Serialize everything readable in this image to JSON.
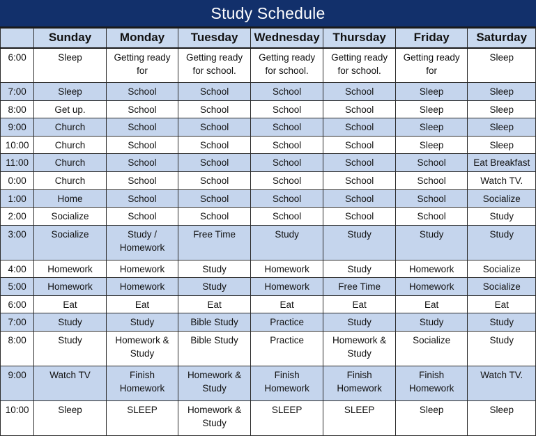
{
  "title": "Study Schedule",
  "table": {
    "corner_header": "",
    "day_headers": [
      "Sunday",
      "Monday",
      "Tuesday",
      "Wednesday",
      "Thursday",
      "Friday",
      "Saturday"
    ],
    "rows": [
      {
        "time": "6:00",
        "height": "tall",
        "shade": "plain",
        "cells": [
          "Sleep",
          "Getting ready for",
          "Getting ready for school.",
          "Getting ready for school.",
          "Getting ready for school.",
          "Getting ready for",
          "Sleep"
        ]
      },
      {
        "time": "7:00",
        "height": "short",
        "shade": "alt",
        "cells": [
          "Sleep",
          "School",
          "School",
          "School",
          "School",
          "Sleep",
          "Sleep"
        ]
      },
      {
        "time": "8:00",
        "height": "short",
        "shade": "plain",
        "cells": [
          "Get up.",
          "School",
          "School",
          "School",
          "School",
          "Sleep",
          "Sleep"
        ]
      },
      {
        "time": "9:00",
        "height": "short",
        "shade": "alt",
        "cells": [
          "Church",
          "School",
          "School",
          "School",
          "School",
          "Sleep",
          "Sleep"
        ]
      },
      {
        "time": "10:00",
        "height": "short",
        "shade": "plain",
        "cells": [
          "Church",
          "School",
          "School",
          "School",
          "School",
          "Sleep",
          "Sleep"
        ]
      },
      {
        "time": "11:00",
        "height": "short",
        "shade": "alt",
        "cells": [
          "Church",
          "School",
          "School",
          "School",
          "School",
          "School",
          "Eat Breakfast"
        ]
      },
      {
        "time": "0:00",
        "height": "short",
        "shade": "plain",
        "cells": [
          "Church",
          "School",
          "School",
          "School",
          "School",
          "School",
          "Watch TV."
        ]
      },
      {
        "time": "1:00",
        "height": "short",
        "shade": "alt",
        "cells": [
          "Home",
          "School",
          "School",
          "School",
          "School",
          "School",
          "Socialize"
        ]
      },
      {
        "time": "2:00",
        "height": "short",
        "shade": "plain",
        "cells": [
          "Socialize",
          "School",
          "School",
          "School",
          "School",
          "School",
          "Study"
        ]
      },
      {
        "time": "3:00",
        "height": "tall",
        "shade": "alt",
        "cells": [
          "Socialize",
          "Study / Homework",
          "Free Time",
          "Study",
          "Study",
          "Study",
          "Study"
        ]
      },
      {
        "time": "4:00",
        "height": "short",
        "shade": "plain",
        "cells": [
          "Homework",
          "Homework",
          "Study",
          "Homework",
          "Study",
          "Homework",
          "Socialize"
        ]
      },
      {
        "time": "5:00",
        "height": "short",
        "shade": "alt",
        "cells": [
          "Homework",
          "Homework",
          "Study",
          "Homework",
          "Free Time",
          "Homework",
          "Socialize"
        ]
      },
      {
        "time": "6:00",
        "height": "short",
        "shade": "plain",
        "cells": [
          "Eat",
          "Eat",
          "Eat",
          "Eat",
          "Eat",
          "Eat",
          "Eat"
        ]
      },
      {
        "time": "7:00",
        "height": "short",
        "shade": "alt",
        "cells": [
          "Study",
          "Study",
          "Bible Study",
          "Practice",
          "Study",
          "Study",
          "Study"
        ]
      },
      {
        "time": "8:00",
        "height": "tall",
        "shade": "plain",
        "cells": [
          "Study",
          "Homework & Study",
          "Bible Study",
          "Practice",
          "Homework & Study",
          "Socialize",
          "Study"
        ]
      },
      {
        "time": "9:00",
        "height": "tall",
        "shade": "alt",
        "cells": [
          "Watch TV",
          "Finish Homework",
          "Homework & Study",
          "Finish Homework",
          "Finish Homework",
          "Finish Homework",
          "Watch TV."
        ]
      },
      {
        "time": "10:00",
        "height": "tall",
        "shade": "plain",
        "cells": [
          "Sleep",
          "SLEEP",
          "Homework & Study",
          "SLEEP",
          "SLEEP",
          "Sleep",
          "Sleep"
        ]
      }
    ]
  },
  "colors": {
    "title_bar": "#12306b",
    "title_text": "#ffffff",
    "header_fill": "#c9d9ef",
    "band_fill": "#c5d5ed",
    "plain_fill": "#ffffff",
    "grid_line": "#2b2b2b",
    "cell_text": "#111111"
  }
}
